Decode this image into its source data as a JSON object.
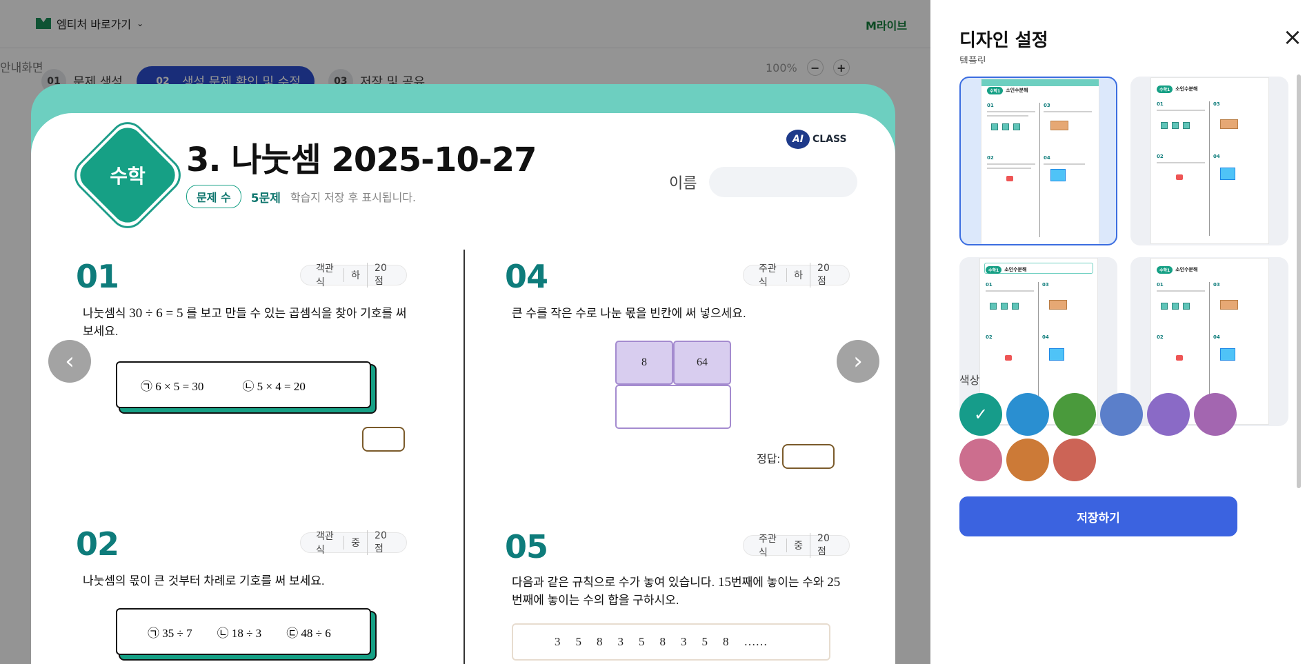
{
  "topbar": {
    "shortcut_label": "엠티처 바로가기",
    "mlive_label": "M라이브"
  },
  "steps": [
    {
      "num": "01",
      "label": "문제 생성"
    },
    {
      "num": "02",
      "label": "생성 문제 확인 및 수정"
    },
    {
      "num": "03",
      "label": "저장 및 공유"
    }
  ],
  "left_partial_text": "안내화면",
  "zoom": {
    "value": "100%",
    "minus": "−",
    "plus": "+"
  },
  "sheet": {
    "subject": "수학",
    "title": "3. 나눗셈 2025-10-27",
    "count_label": "문제 수",
    "count_value": "5문제",
    "note": "학습지 저장 후 표시됩니다.",
    "ai_badge": "AI",
    "class_label": "CLASS",
    "name_label": "이름"
  },
  "questions": {
    "q01": {
      "num": "01",
      "tags": [
        "객관식",
        "하",
        "20점"
      ],
      "text_a": "나눗셈식 ",
      "math_a": "30 ÷ 6 = 5",
      "text_b": "를 보고 만들 수 있는 곱셈식을 찾아 기호를 써 보세요.",
      "choices": [
        "㉠ 6 × 5 = 30",
        "㉡ 5 × 4 = 20"
      ]
    },
    "q02": {
      "num": "02",
      "tags": [
        "객관식",
        "중",
        "20점"
      ],
      "text": "나눗셈의 몫이 큰 것부터 차례로 기호를 써 보세요.",
      "choices": [
        "㉠ 35 ÷ 7",
        "㉡ 18 ÷ 3",
        "㉢ 48 ÷ 6"
      ]
    },
    "q04": {
      "num": "04",
      "tags": [
        "주관식",
        "하",
        "20점"
      ],
      "text": "큰 수를 작은 수로 나눈 몫을 빈칸에 써 넣으세요.",
      "cells": [
        "8",
        "64"
      ],
      "answer_label": "정답:"
    },
    "q05": {
      "num": "05",
      "tags": [
        "주관식",
        "중",
        "20점"
      ],
      "text_a": "다음과 같은 규칙으로 수가 놓여 있습니다. ",
      "math_a": "15",
      "text_b": "번째에 놓이는 수와 ",
      "math_b": "25",
      "text_c": "번째에 놓이는 수의 합을 구하시오.",
      "sequence": [
        "3",
        "5",
        "8",
        "3",
        "5",
        "8",
        "3",
        "5",
        "8",
        "……"
      ]
    }
  },
  "nav": {
    "prev": "‹",
    "next": "›"
  },
  "panel": {
    "title": "디자인 설정",
    "close": "×",
    "section_template": "템플릿",
    "thumb_title": "소인수분해",
    "thumb_subject": "수학1",
    "color_label": "색상",
    "save_label": "저장하기",
    "check_mark": "✓",
    "swatches": [
      "#169c8a",
      "#2a8fd1",
      "#4a9a3c",
      "#5b7fca",
      "#8a6ac6",
      "#a366b0",
      "#cc6e8e",
      "#cc7a37",
      "#cc6456"
    ]
  }
}
